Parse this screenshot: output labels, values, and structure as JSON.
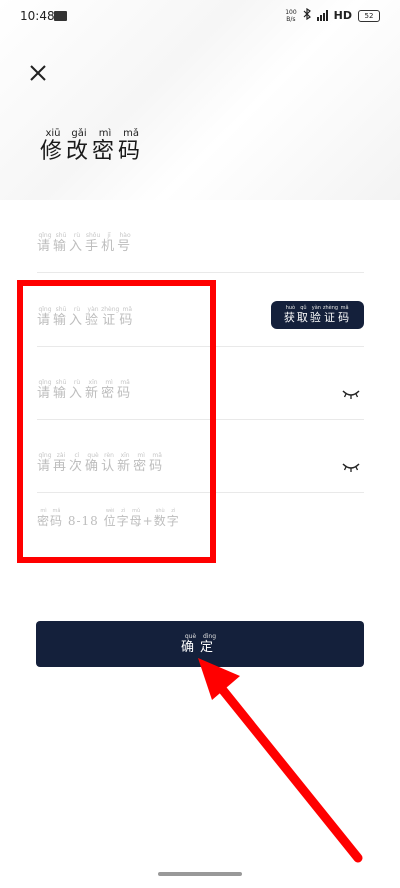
{
  "status_bar": {
    "time": "10:48",
    "speed_value": "100",
    "speed_unit": "B/s",
    "network": "HD",
    "battery": "52"
  },
  "icons": {
    "close": "close-icon",
    "eye_closed": "eye-closed-icon"
  },
  "title": {
    "chars": [
      {
        "h": "修",
        "p": "xiū"
      },
      {
        "h": "改",
        "p": "gǎi"
      },
      {
        "h": "密",
        "p": "mì"
      },
      {
        "h": "码",
        "p": "mǎ"
      }
    ]
  },
  "fields": {
    "phone": {
      "placeholder": [
        {
          "h": "请",
          "p": "qǐng"
        },
        {
          "h": "输",
          "p": "shū"
        },
        {
          "h": "入",
          "p": "rù"
        },
        {
          "h": "手",
          "p": "shǒu"
        },
        {
          "h": "机",
          "p": "jī"
        },
        {
          "h": "号",
          "p": "hào"
        }
      ]
    },
    "code": {
      "placeholder": [
        {
          "h": "请",
          "p": "qǐng"
        },
        {
          "h": "输",
          "p": "shū"
        },
        {
          "h": "入",
          "p": "rù"
        },
        {
          "h": "验",
          "p": "yàn"
        },
        {
          "h": "证",
          "p": "zhèng"
        },
        {
          "h": "码",
          "p": "mǎ"
        }
      ],
      "button": [
        {
          "h": "获",
          "p": "huò"
        },
        {
          "h": "取",
          "p": "qǔ"
        },
        {
          "h": "验",
          "p": "yàn"
        },
        {
          "h": "证",
          "p": "zhèng"
        },
        {
          "h": "码",
          "p": "mǎ"
        }
      ]
    },
    "new_password": {
      "placeholder": [
        {
          "h": "请",
          "p": "qǐng"
        },
        {
          "h": "输",
          "p": "shū"
        },
        {
          "h": "入",
          "p": "rù"
        },
        {
          "h": "新",
          "p": "xīn"
        },
        {
          "h": "密",
          "p": "mì"
        },
        {
          "h": "码",
          "p": "mǎ"
        }
      ]
    },
    "confirm_password": {
      "placeholder": [
        {
          "h": "请",
          "p": "qǐng"
        },
        {
          "h": "再",
          "p": "zài"
        },
        {
          "h": "次",
          "p": "cì"
        },
        {
          "h": "确",
          "p": "què"
        },
        {
          "h": "认",
          "p": "rèn"
        },
        {
          "h": "新",
          "p": "xīn"
        },
        {
          "h": "密",
          "p": "mì"
        },
        {
          "h": "码",
          "p": "mǎ"
        }
      ]
    }
  },
  "hint": [
    {
      "h": "密",
      "p": "mì"
    },
    {
      "h": "码",
      "p": "mǎ"
    },
    {
      "h": " 8-18 ",
      "p": ""
    },
    {
      "h": "位",
      "p": "wèi"
    },
    {
      "h": "字",
      "p": "zì"
    },
    {
      "h": "母",
      "p": "mǔ"
    },
    {
      "h": "+",
      "p": ""
    },
    {
      "h": "数",
      "p": "shù"
    },
    {
      "h": "字",
      "p": "zì"
    }
  ],
  "confirm_button": [
    {
      "h": "确",
      "p": "què"
    },
    {
      "h": "定",
      "p": "dìng"
    }
  ],
  "colors": {
    "primary": "#14203b",
    "placeholder": "#bdbdbd",
    "annotation": "#ff0000"
  }
}
